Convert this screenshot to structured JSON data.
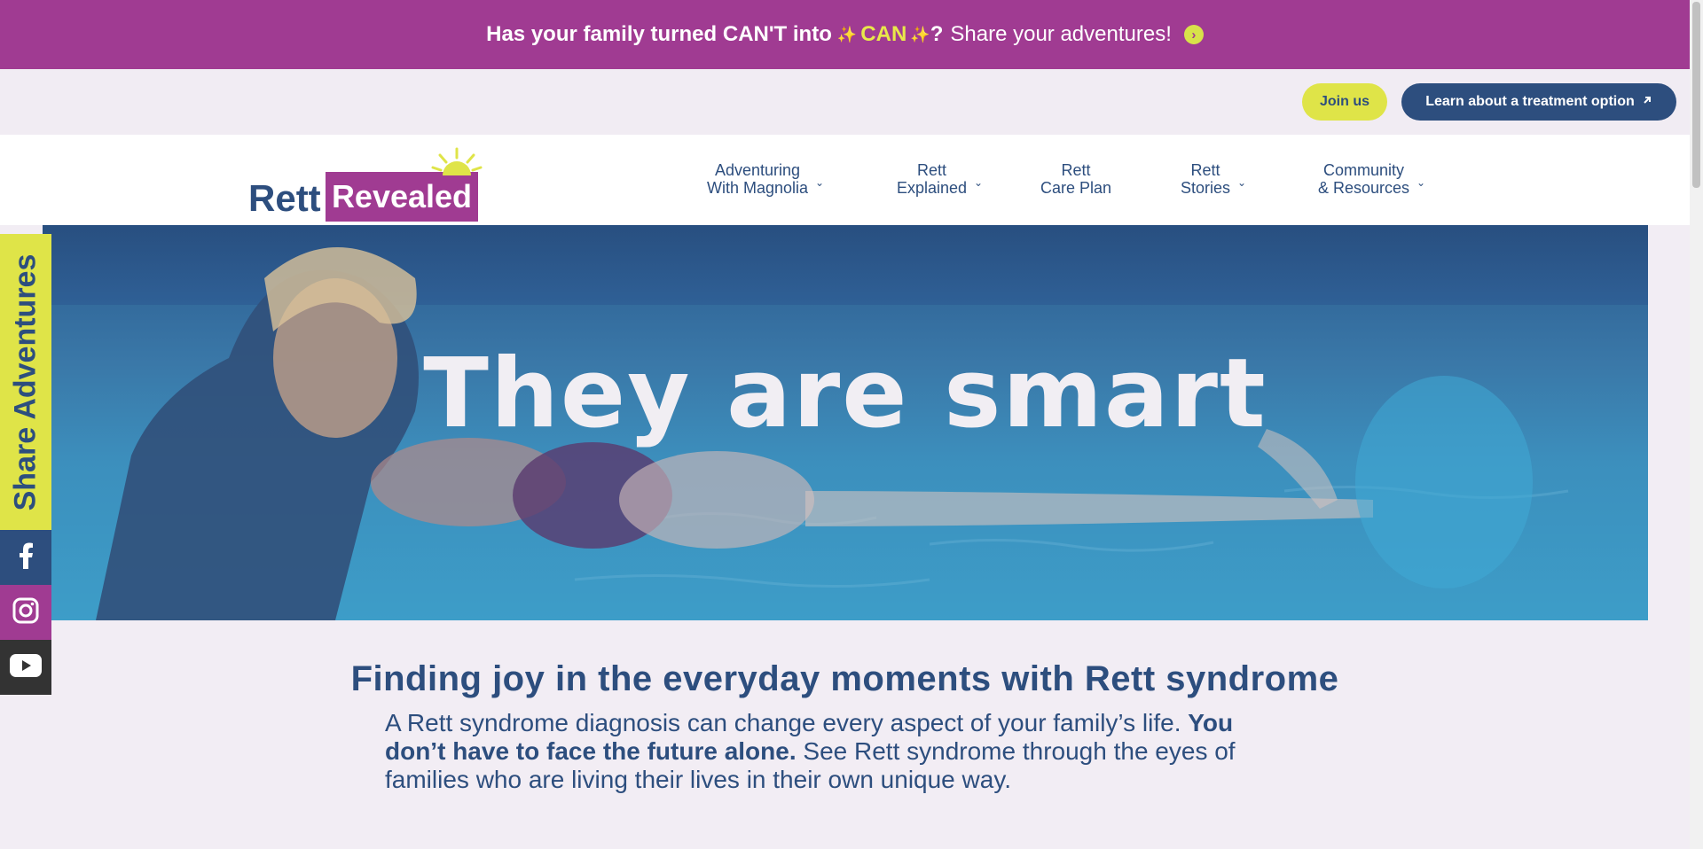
{
  "promo": {
    "part1": "Has your family turned CAN'T into",
    "sparkle": "✨",
    "can": "CAN",
    "question": "?",
    "part2": "Share your adventures!"
  },
  "utility": {
    "join_label": "Join us",
    "learn_label": "Learn about a treatment option"
  },
  "logo": {
    "rett": "Rett",
    "revealed": "Revealed"
  },
  "nav": {
    "items": [
      {
        "line1": "Adventuring",
        "line2": "With Magnolia",
        "dropdown": true
      },
      {
        "line1": "Rett",
        "line2": "Explained",
        "dropdown": true
      },
      {
        "line1": "Rett",
        "line2": "Care Plan",
        "dropdown": false
      },
      {
        "line1": "Rett",
        "line2": "Stories",
        "dropdown": true
      },
      {
        "line1": "Community",
        "line2": "& Resources",
        "dropdown": true
      }
    ]
  },
  "hero": {
    "title": "They are smart"
  },
  "sidebar": {
    "share_label": "Share Adventures",
    "social": [
      "facebook-icon",
      "instagram-icon",
      "youtube-icon"
    ]
  },
  "content": {
    "title": "Finding joy in the everyday moments with Rett syndrome",
    "body_part1": "A Rett syndrome diagnosis can change every aspect of your family’s life.",
    "body_bold": "You don’t have to face the future alone.",
    "body_part2": "See Rett syndrome through the eyes of families who are living their lives in their own unique way."
  },
  "colors": {
    "purple": "#a03b92",
    "navy": "#2d4e7e",
    "yellow": "#dfe448",
    "background": "#f2edf4"
  }
}
